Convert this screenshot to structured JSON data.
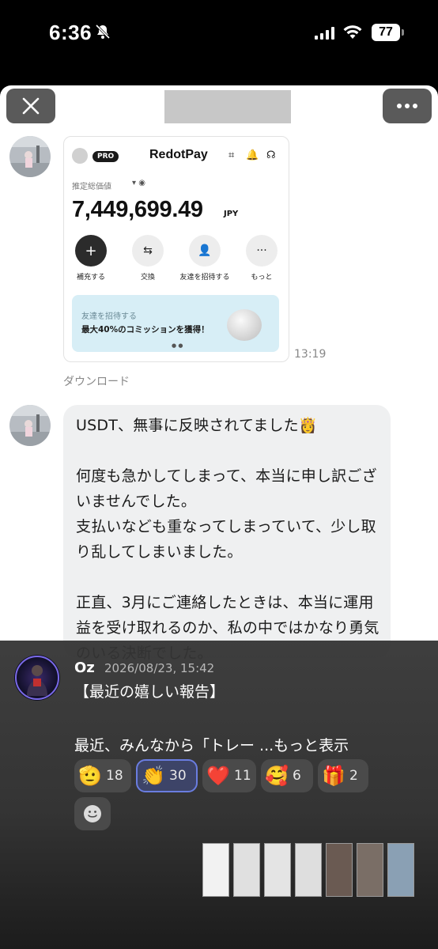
{
  "status_bar": {
    "time": "6:36",
    "battery": "77"
  },
  "redotpay": {
    "pro_badge": "PRO",
    "brand": "RedotPay",
    "total_label": "推定総価値",
    "amount": "7,449,699.49",
    "currency": "JPY",
    "actions": [
      {
        "label": "補充する"
      },
      {
        "label": "交換"
      },
      {
        "label": "友達を招待する"
      },
      {
        "label": "もっと"
      }
    ],
    "banner_line1": "友達を招待する",
    "banner_line2": "最大40%のコミッションを獲得！"
  },
  "chat": {
    "image_time": "13:19",
    "download_label": "ダウンロード",
    "message": "USDT、無事に反映されてました👸\n\n何度も急かしてしまって、本当に申し訳ございませんでした。\n支払いなども重なってしまっていて、少し取り乱してしまいました。\n\n正直、3月にご連絡したときは、本当に運用益を受け取れるのか、私の中ではかなり勇気のいる決断でした。"
  },
  "post": {
    "author": "Oz",
    "date": "2026/08/23, 15:42",
    "body": "【最近の嬉しい報告】\n\n最近、みんなから「トレー ...",
    "more_label": "もっと表示",
    "reactions": [
      {
        "emoji": "🫡",
        "count": "18"
      },
      {
        "emoji": "👏",
        "count": "30"
      },
      {
        "emoji": "❤️",
        "count": "11"
      },
      {
        "emoji": "🥰",
        "count": "6"
      },
      {
        "emoji": "🎁",
        "count": "2"
      }
    ]
  },
  "colors": {
    "overlay_bg": "#343434",
    "active_reaction_border": "#6a7de0",
    "bubble_bg": "#eff0f1"
  }
}
